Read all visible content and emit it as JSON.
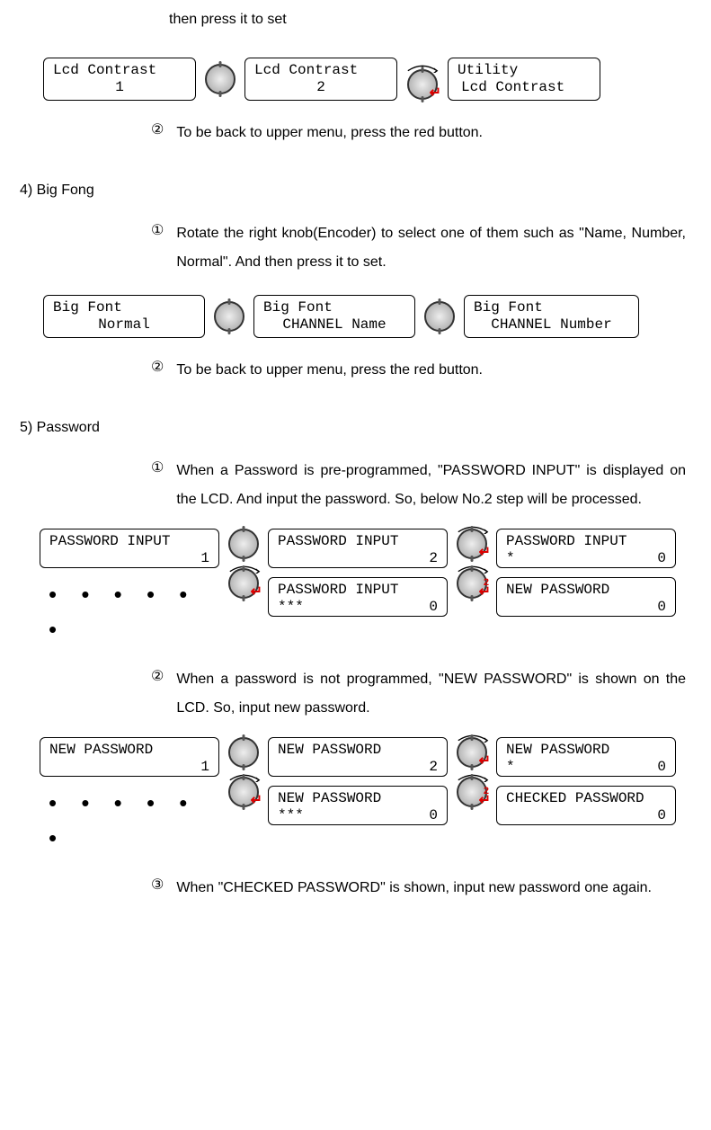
{
  "intro_tail": "then press it to set",
  "lcd_row1": {
    "box1": {
      "l1": "Lcd Contrast",
      "l2": "1"
    },
    "box2": {
      "l1": "Lcd Contrast",
      "l2": "2"
    },
    "box3": {
      "l1": "Utility",
      "l2": "Lcd Contrast"
    }
  },
  "step_back": {
    "circ": "②",
    "txt": "To be back to upper menu, press the red button."
  },
  "sec4": {
    "head": "4)   Big Fong",
    "step1": {
      "circ": "①",
      "txt": "Rotate the right knob(Encoder) to select one of them such as \"Name, Number, Normal\". And then press it to set."
    },
    "row": {
      "box1": {
        "l1": "Big Font",
        "l2": "Normal"
      },
      "box2": {
        "l1": "Big Font",
        "l2": "CHANNEL Name"
      },
      "box3": {
        "l1": "Big Font",
        "l2": "CHANNEL Number"
      }
    },
    "step2": {
      "circ": "②",
      "txt": "To be back to upper menu, press the red button."
    }
  },
  "sec5": {
    "head": "5)   Password",
    "step1": {
      "circ": "①",
      "txt": "When a Password is pre-programmed, \"PASSWORD INPUT\" is displayed on the LCD. And input the password. So, below No.2 step will be processed."
    },
    "flow1": {
      "b1": {
        "l1": "PASSWORD INPUT",
        "r": "1"
      },
      "b2": {
        "l1": "PASSWORD INPUT",
        "r": "2"
      },
      "b3": {
        "l1": "PASSWORD INPUT",
        "l2l": "***",
        "l2r": "0"
      },
      "b4": {
        "l1": "PASSWORD INPUT",
        "l2l": "*",
        "l2r": "0"
      },
      "b5": {
        "l1": "NEW PASSWORD",
        "r": "0"
      }
    },
    "step2": {
      "circ": "②",
      "txt": "When a password is not programmed, \"NEW   PASSWORD\" is shown on the LCD. So, input new password."
    },
    "flow2": {
      "b1": {
        "l1": "NEW PASSWORD",
        "r": "1"
      },
      "b2": {
        "l1": "NEW PASSWORD",
        "r": "2"
      },
      "b3": {
        "l1": "NEW PASSWORD",
        "l2l": "***",
        "l2r": "0"
      },
      "b4": {
        "l1": "NEW PASSWORD",
        "l2l": "*",
        "l2r": "0"
      },
      "b5": {
        "l1": "CHECKED PASSWORD",
        "r": "0"
      }
    },
    "step3": {
      "circ": "③",
      "txt": "When \"CHECKED PASSWORD\" is shown, input new password one again."
    }
  },
  "dots": "• •   • •   • •"
}
